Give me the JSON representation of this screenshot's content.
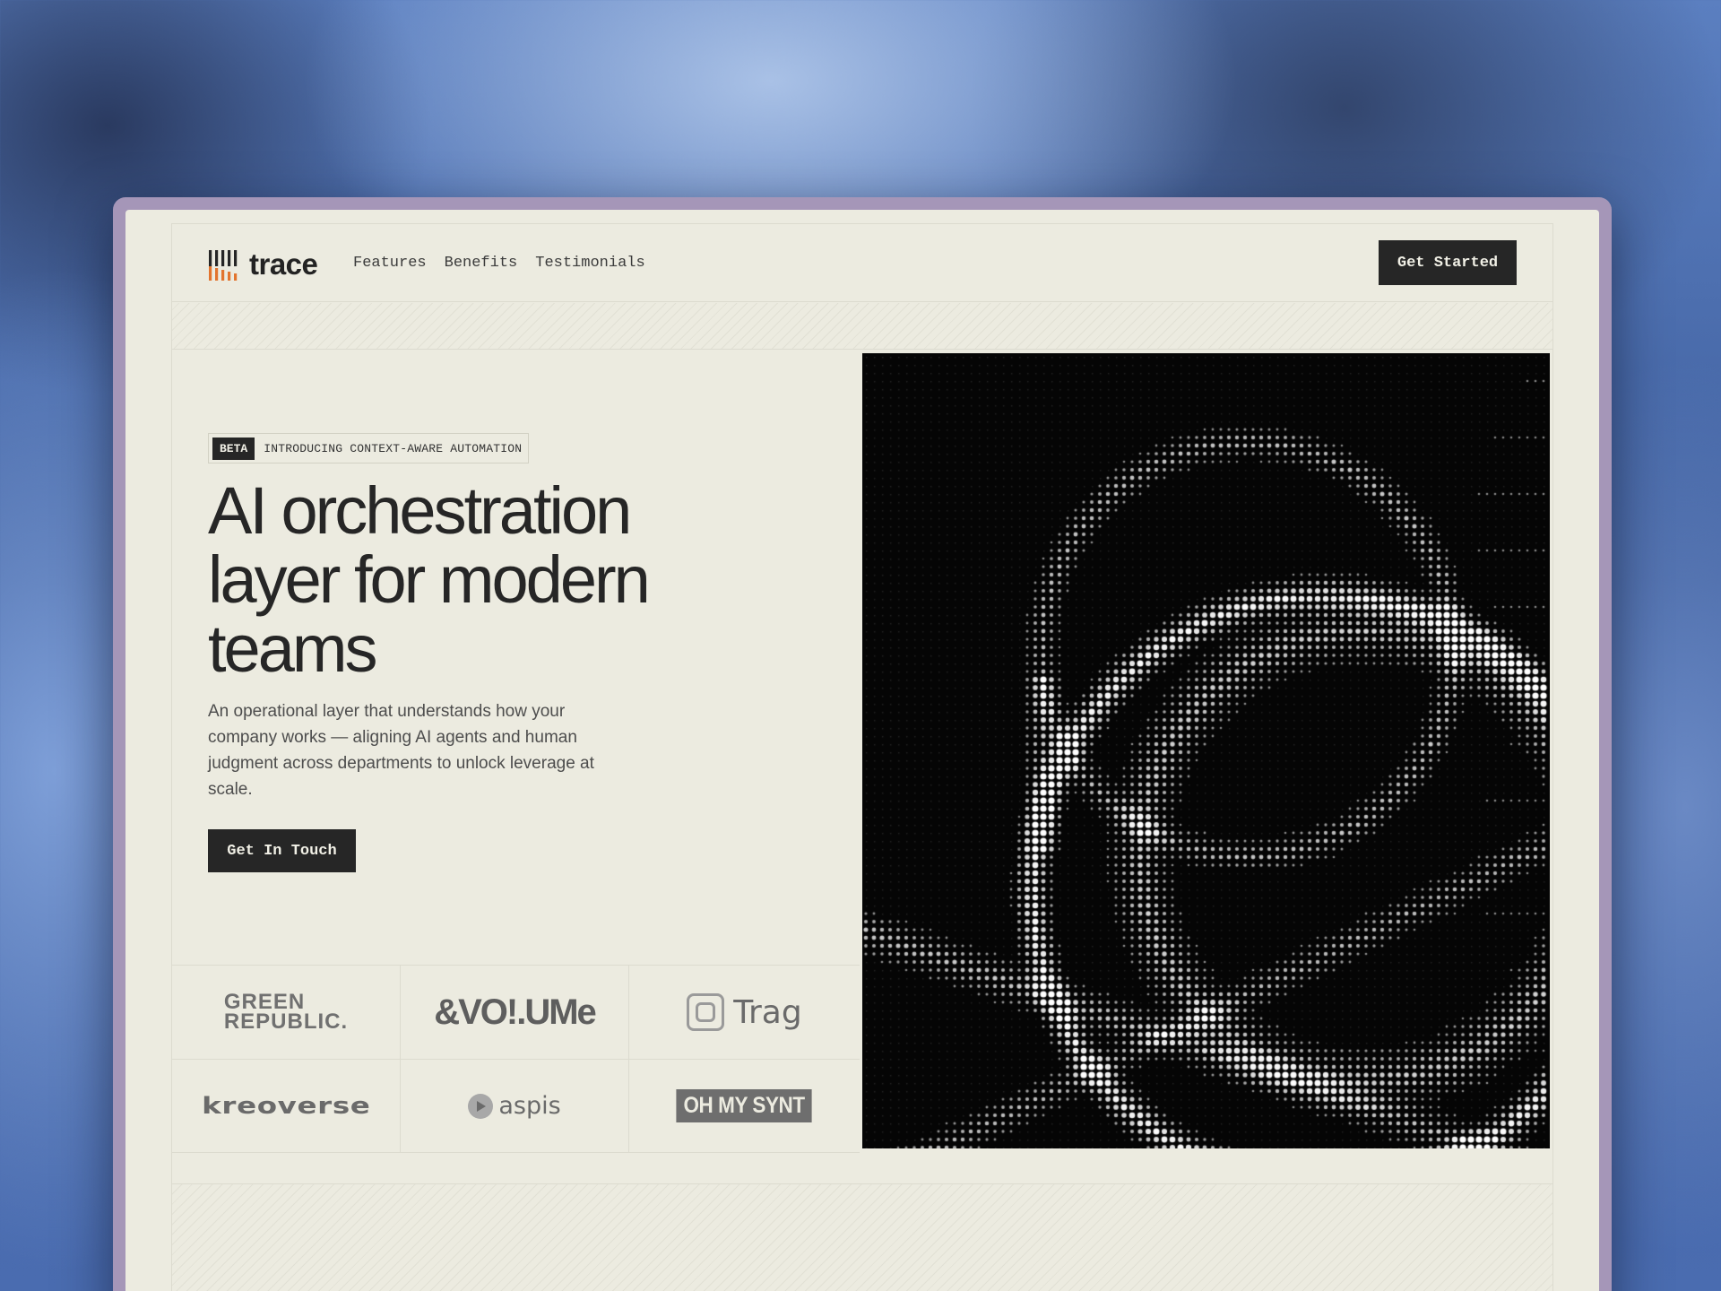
{
  "brand": {
    "name": "trace",
    "accent": "#e2742e"
  },
  "nav": {
    "links": [
      "Features",
      "Benefits",
      "Testimonials"
    ],
    "cta": "Get Started"
  },
  "hero": {
    "badge_tag": "BETA",
    "badge_text": "INTRODUCING CONTEXT-AWARE AUTOMATION",
    "headline_lines": [
      "AI orchestration",
      "layer for modern",
      "teams"
    ],
    "subtext": "An operational layer that understands how your company works — aligning AI agents and human judgment across departments to unlock leverage at scale.",
    "cta": "Get In Touch",
    "image": "dithered-portrait"
  },
  "logos": {
    "green_republic": [
      "GREEN",
      "REPUBLIC."
    ],
    "volume": "&VO!.UMe",
    "trag": "Trag",
    "kreoverse": "kreoverse",
    "aspis": "aspis",
    "synt": "OH MY SYNT"
  },
  "colors": {
    "background": "#ecebe0",
    "dark": "#262626",
    "frame": "#a596b8"
  }
}
